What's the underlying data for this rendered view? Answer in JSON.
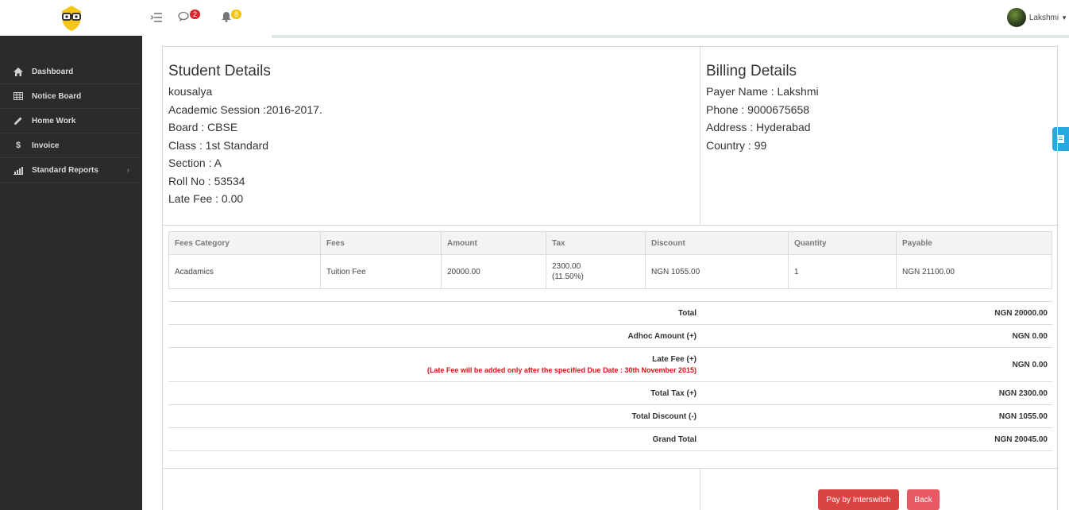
{
  "user": {
    "name": "Lakshmi"
  },
  "topbar": {
    "messages_count": "2",
    "notifications_count": "8"
  },
  "sidebar": {
    "items": [
      {
        "label": "Dashboard",
        "icon": "home-icon"
      },
      {
        "label": "Notice Board",
        "icon": "table-icon"
      },
      {
        "label": "Home Work",
        "icon": "pencil-icon"
      },
      {
        "label": "Invoice",
        "icon": "dollar-icon"
      },
      {
        "label": "Standard Reports",
        "icon": "bar-chart-icon"
      }
    ]
  },
  "student": {
    "heading": "Student Details",
    "name": "kousalya",
    "session": "Academic Session :2016-2017.",
    "board": "Board : CBSE",
    "class": "Class : 1st Standard",
    "section": "Section : A",
    "roll": "Roll No : 53534",
    "late_fee": "Late Fee : 0.00"
  },
  "billing": {
    "heading": "Billing Details",
    "payer": "Payer Name : Lakshmi",
    "phone": "Phone : 9000675658",
    "address": "Address : Hyderabad",
    "country": "Country : 99"
  },
  "fees_table": {
    "headers": [
      "Fees Category",
      "Fees",
      "Amount",
      "Tax",
      "Discount",
      "Quantity",
      "Payable"
    ],
    "row": {
      "category": "Acadamics",
      "fees": "Tuition Fee",
      "amount": "20000.00",
      "tax": "2300.00",
      "tax_pct": "(11.50%)",
      "discount": "NGN  1055.00",
      "quantity": "1",
      "payable": "NGN  21100.00"
    }
  },
  "totals": {
    "total_label": "Total",
    "total_value": "NGN  20000.00",
    "adhoc_label": "Adhoc Amount (+)",
    "adhoc_value": "NGN  0.00",
    "late_label": "Late Fee (+)",
    "late_note": "(Late Fee will be added only after the specified Due Date : 30th November 2015)",
    "late_value": "NGN  0.00",
    "tax_label": "Total Tax (+)",
    "tax_value": "NGN  2300.00",
    "discount_label": "Total Discount (-)",
    "discount_value": "NGN  1055.00",
    "grand_label": "Grand Total",
    "grand_value": "NGN  20045.00"
  },
  "actions": {
    "pay_label": "Pay by Interswitch",
    "back_label": "Back"
  },
  "colors": {
    "sidebar_bg": "#2b2b2b",
    "pay_button": "#d64541",
    "back_button": "#e85a63",
    "late_note": "#d01616",
    "float_tab": "#29a8e0"
  }
}
